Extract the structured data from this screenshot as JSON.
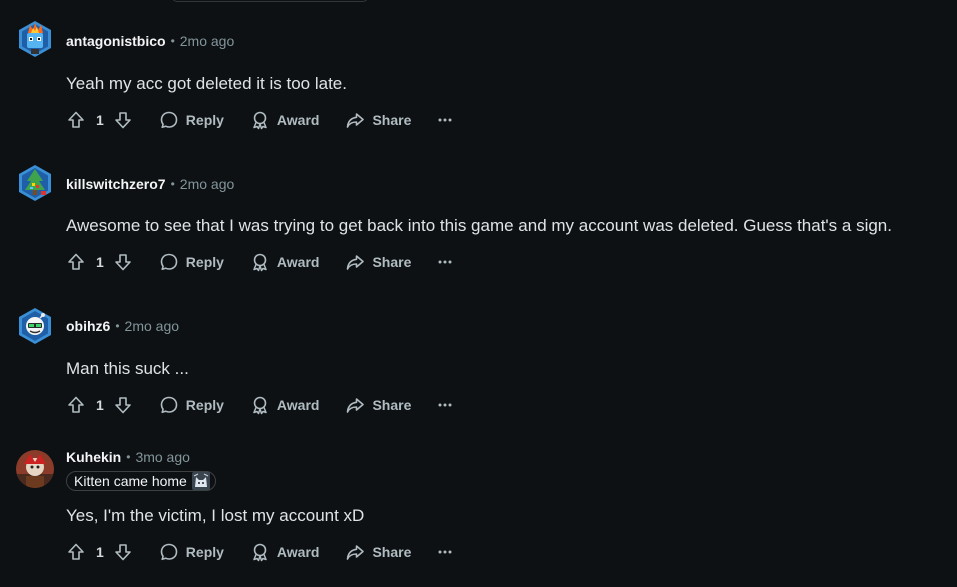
{
  "comments": [
    {
      "username": "antagonistbico",
      "time": "2mo ago",
      "body": "Yeah my acc got deleted it is too late.",
      "score": "1",
      "avatar": "avatar-fire-icon"
    },
    {
      "username": "killswitchzero7",
      "time": "2mo ago",
      "body": "Awesome to see that I was trying to get back into this game and my account was deleted. Guess that's a sign.",
      "score": "1",
      "avatar": "avatar-tree-icon"
    },
    {
      "username": "obihz6",
      "time": "2mo ago",
      "body": "Man this suck ...",
      "score": "1",
      "avatar": "avatar-robot-icon"
    },
    {
      "username": "Kuhekin",
      "time": "3mo ago",
      "flair": "Kitten came home",
      "body": "Yes, I'm the victim, I lost my account xD",
      "score": "1",
      "avatar": "avatar-profile-photo"
    }
  ],
  "actions": {
    "reply": "Reply",
    "award": "Award",
    "share": "Share"
  },
  "colors": {
    "background": "#0e1113",
    "text": "#dfe3e5",
    "muted": "#82959b",
    "action": "#b0bcc2"
  }
}
